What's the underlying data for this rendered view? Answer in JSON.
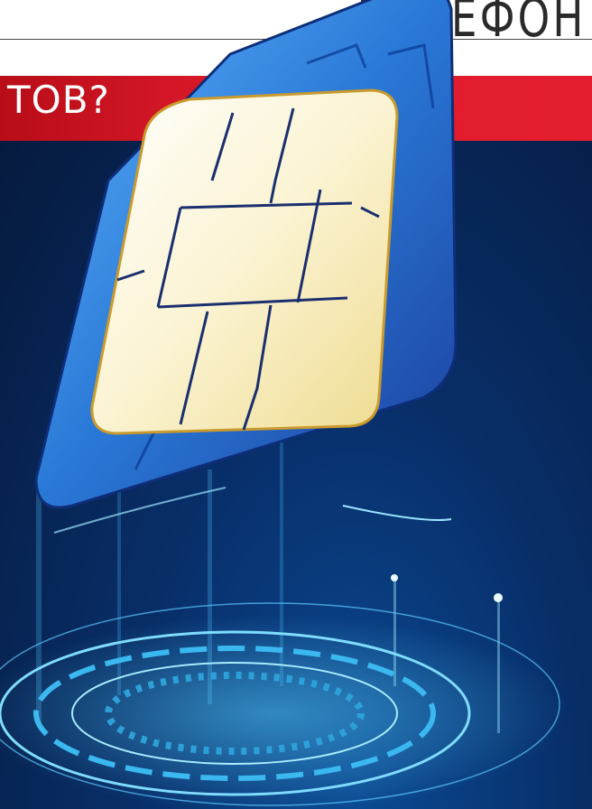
{
  "header": {
    "section_title": "ТЕЛЕФОН"
  },
  "banner": {
    "headline": "ТОВ?",
    "color": "#e41e2e"
  },
  "illustration": {
    "subject": "sim-card-chip",
    "background_color": "#082e68",
    "accent_color": "#3fb5ff"
  }
}
